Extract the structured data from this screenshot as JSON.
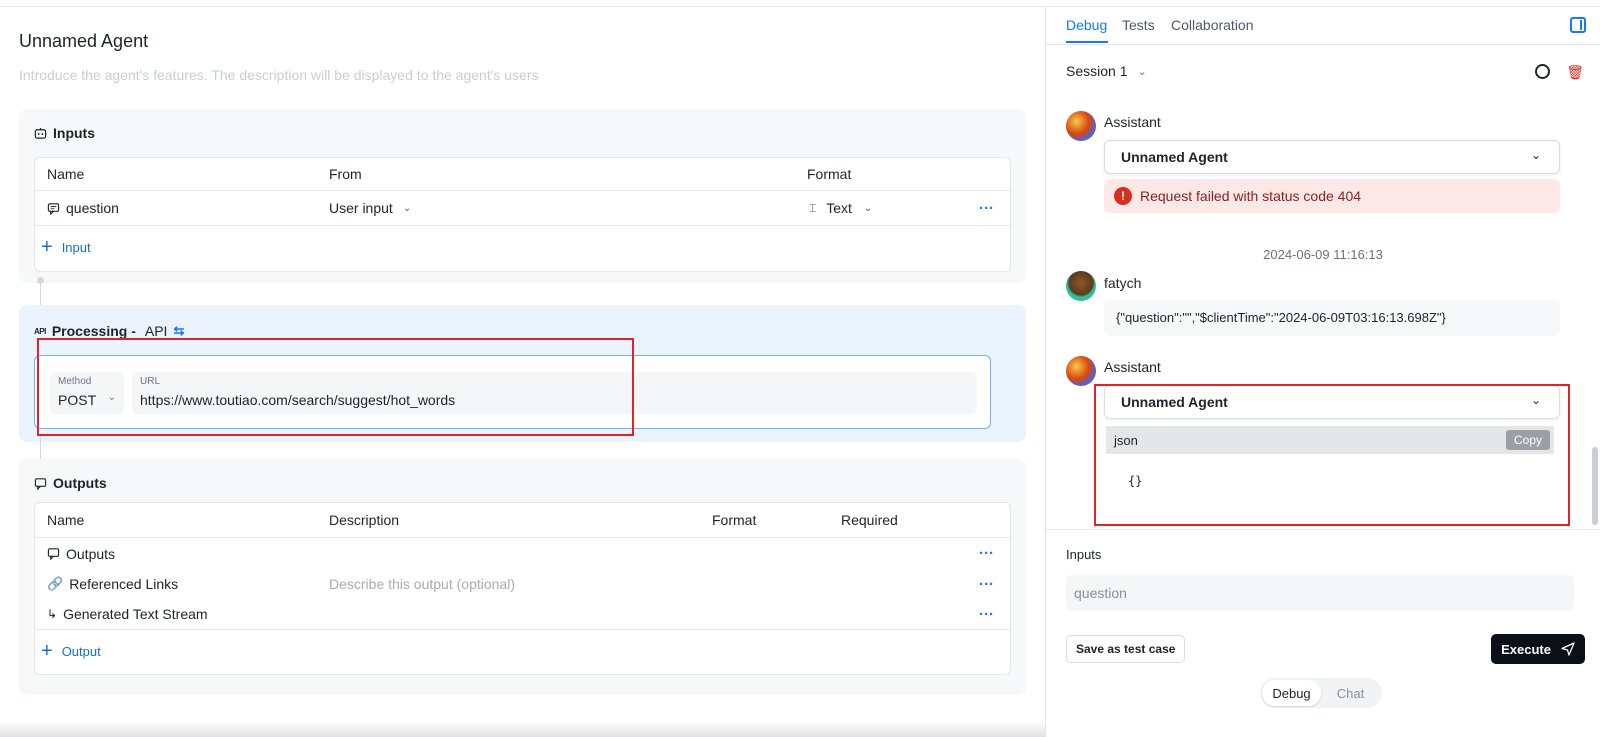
{
  "left": {
    "title": "Unnamed Agent",
    "description_placeholder": "Introduce the agent's features. The description will be displayed to the agent's users",
    "inputs": {
      "header": "Inputs",
      "columns": [
        "Name",
        "From",
        "Format"
      ],
      "rows": [
        {
          "name": "question",
          "from": "User input",
          "format": "Text",
          "icon": "chat-icon"
        }
      ],
      "add_label": "Input"
    },
    "processing": {
      "header_prefix": "Processing -",
      "header_api": "API",
      "method_label": "Method",
      "method_value": "POST",
      "url_label": "URL",
      "url_value": "https://www.toutiao.com/search/suggest/hot_words"
    },
    "outputs": {
      "header": "Outputs",
      "columns": [
        "Name",
        "Description",
        "Format",
        "Required"
      ],
      "rows": [
        {
          "name": "Outputs",
          "description": "",
          "icon": "chat-icon"
        },
        {
          "name": "Referenced Links",
          "description": "Describe this output (optional)",
          "icon": "link-icon"
        },
        {
          "name": "Generated Text Stream",
          "description": "",
          "icon": "stream-icon"
        }
      ],
      "add_label": "Output"
    }
  },
  "right": {
    "tabs": [
      "Debug",
      "Tests",
      "Collaboration"
    ],
    "active_tab": "Debug",
    "session": "Session 1",
    "messages": {
      "assistant_label": "Assistant",
      "agent_name": "Unnamed Agent",
      "error_text": "Request failed with status code 404",
      "timestamp": "2024-06-09 11:16:13",
      "user_name": "fatych",
      "user_message": "{\"question\":\"\",\"$clientTime\":\"2024-06-09T03:16:13.698Z\"}",
      "assistant2_label": "Assistant",
      "agent2_name": "Unnamed Agent",
      "code_lang": "json",
      "copy_label": "Copy",
      "code_content": "{}"
    },
    "inputs_label": "Inputs",
    "question_placeholder": "question",
    "save_label": "Save as test case",
    "execute_label": "Execute",
    "mode_options": [
      "Debug",
      "Chat"
    ]
  },
  "colors": {
    "accent": "#1677ff",
    "error_bg": "#fde8e8",
    "highlight_rect": "#e02424",
    "processing_bg": "#eaf3fe"
  }
}
